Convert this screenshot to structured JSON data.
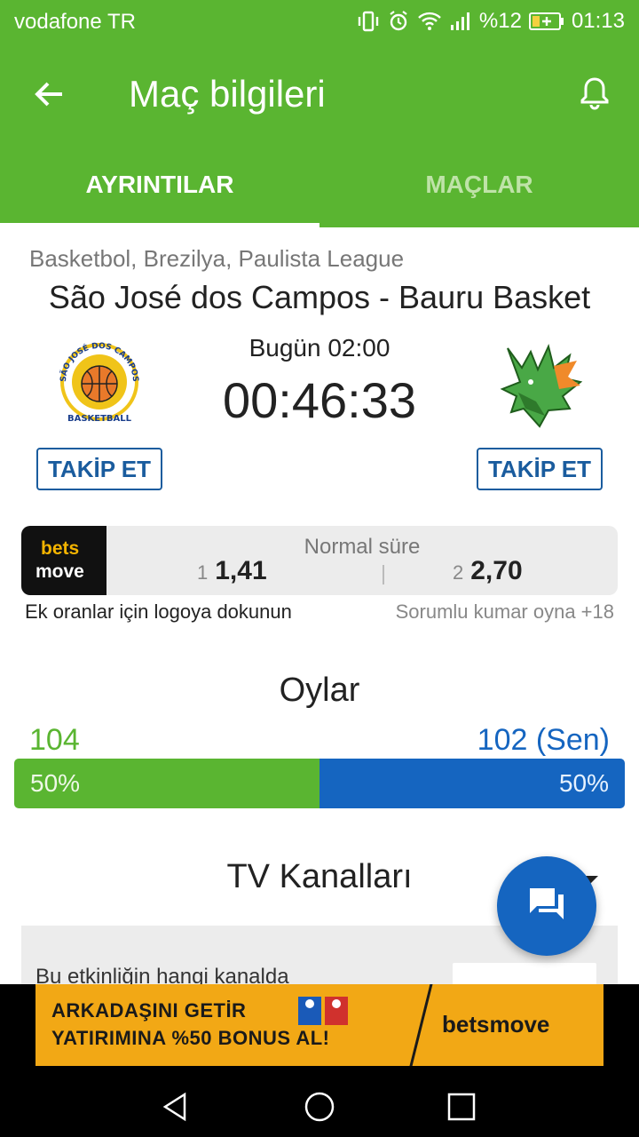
{
  "status_bar": {
    "carrier": "vodafone TR",
    "battery": "%12",
    "time": "01:13"
  },
  "app_bar": {
    "title": "Maç bilgileri"
  },
  "tabs": [
    {
      "label": "AYRINTILAR",
      "active": true
    },
    {
      "label": "MAÇLAR",
      "active": false
    }
  ],
  "match": {
    "league": "Basketbol, Brezilya, Paulista League",
    "title": "São José dos Campos - Bauru Basket",
    "kickoff": "Bugün 02:00",
    "countdown": "00:46:33",
    "home_follow": "TAKİP ET",
    "away_follow": "TAKİP ET",
    "home_logo_text_top": "SÃO JOSÉ DOS CAMPOS",
    "home_logo_text_bottom": "BASKETBALL"
  },
  "odds": {
    "bookmaker_line1": "bets",
    "bookmaker_line2": "move",
    "period": "Normal süre",
    "home_key": "1",
    "home_value": "1,41",
    "away_key": "2",
    "away_value": "2,70",
    "hint": "Ek oranlar için logoya dokunun",
    "responsible": "Sorumlu kumar oyna +18"
  },
  "votes": {
    "title": "Oylar",
    "home_count": "104",
    "away_count": "102 (Sen)",
    "home_percent_label": "50%",
    "away_percent_label": "50%",
    "home_share": 0.5
  },
  "tv": {
    "title": "TV Kanalları",
    "question": "Bu etkinliğin hangi kanalda"
  },
  "ad": {
    "line1": "ARKADAŞINI GETİR",
    "line2": "YATIRIMINA %50 BONUS AL!",
    "brand": "betsmove"
  },
  "colors": {
    "primary_green": "#5ab531",
    "primary_blue": "#1565c0",
    "follow_blue": "#1a5c9e",
    "ad_orange": "#f2a815"
  }
}
